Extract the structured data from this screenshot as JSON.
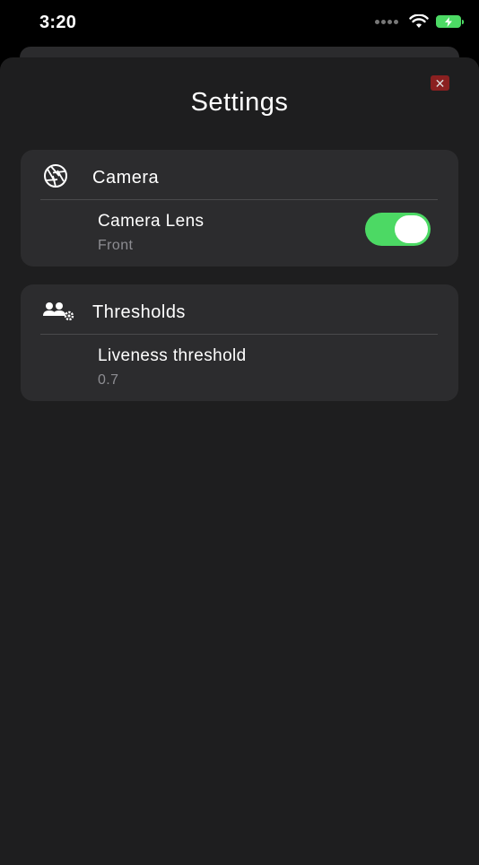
{
  "status_bar": {
    "time": "3:20"
  },
  "sheet": {
    "title": "Settings",
    "close_label": "✕"
  },
  "sections": {
    "camera": {
      "title": "Camera",
      "icon": "aperture-icon",
      "setting": {
        "label": "Camera Lens",
        "value": "Front",
        "toggle_on": true
      }
    },
    "thresholds": {
      "title": "Thresholds",
      "icon": "users-settings-icon",
      "setting": {
        "label": "Liveness threshold",
        "value": "0.7"
      }
    }
  },
  "colors": {
    "accent_toggle": "#4cd964",
    "close_button": "#8a2020",
    "sheet_background": "#1e1e1f",
    "card_background": "#2c2c2e"
  }
}
